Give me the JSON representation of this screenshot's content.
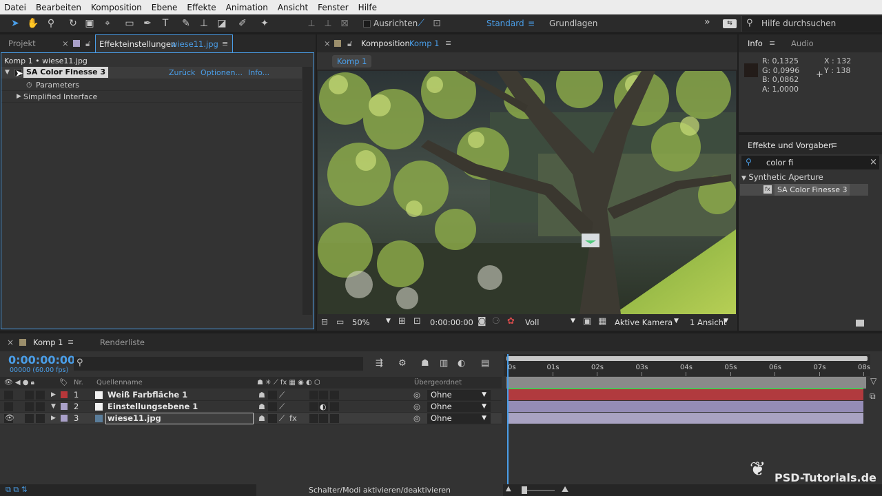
{
  "menu": [
    "Datei",
    "Bearbeiten",
    "Komposition",
    "Ebene",
    "Effekte",
    "Animation",
    "Ansicht",
    "Fenster",
    "Hilfe"
  ],
  "toolbar": {
    "ausrichten": "Ausrichten",
    "workspace_active": "Standard",
    "workspace_other": "Grundlagen",
    "help_placeholder": "Hilfe durchsuchen"
  },
  "left_panel": {
    "tab_project": "Projekt",
    "tab_effects": "Effekteinstellungen",
    "tab_effects_file": "wiese11.jpg",
    "breadcrumb": "Komp 1 • wiese11.jpg",
    "effect_name": "SA Color Finesse 3",
    "link_back": "Zurück",
    "link_options": "Optionen...",
    "link_info": "Info...",
    "items": [
      "Parameters",
      "Simplified Interface"
    ]
  },
  "viewer": {
    "tab_label": "Komposition",
    "tab_comp": "Komp 1",
    "chip": "Komp 1",
    "zoom": "50%",
    "time": "0:00:00:00",
    "resolution": "Voll",
    "camera": "Aktive Kamera",
    "views": "1 Ansicht"
  },
  "info_panel": {
    "tab_info": "Info",
    "tab_audio": "Audio",
    "r": "R:  0,1325",
    "g": "G:  0,0996",
    "b": "B:  0,0862",
    "a": "A:  1,0000",
    "x": "X : 132",
    "y": "Y : 138",
    "sample_color": "#231c19"
  },
  "effects_panel": {
    "title": "Effekte und Vorgaben",
    "search_value": "color fi",
    "category": "Synthetic Aperture",
    "item": "SA Color Finesse 3"
  },
  "timeline": {
    "tab_comp": "Komp 1",
    "tab_render": "Renderliste",
    "timecode": "0:00:00:00",
    "frames": "00000 (60.00 fps)",
    "col_nr": "Nr.",
    "col_source": "Quellenname",
    "col_parent": "Übergeordnet",
    "ruler": [
      "0s",
      "01s",
      "02s",
      "03s",
      "04s",
      "05s",
      "06s",
      "07s",
      "08s"
    ],
    "layers": [
      {
        "nr": "1",
        "name": "Weiß Farbfläche 1",
        "label_color": "#b8373a",
        "parent": "Ohne",
        "bar_color": "#b13a3e"
      },
      {
        "nr": "2",
        "name": "Einstellungsebene 1",
        "label_color": "#a9a0c8",
        "parent": "Ohne",
        "bar_color": "#948cb6"
      },
      {
        "nr": "3",
        "name": "wiese11.jpg",
        "label_color": "#a9a0c8",
        "parent": "Ohne",
        "bar_color": "#a9a3c2"
      }
    ],
    "status": "Schalter/Modi aktivieren/deaktivieren"
  },
  "watermark": "PSD-Tutorials.de"
}
